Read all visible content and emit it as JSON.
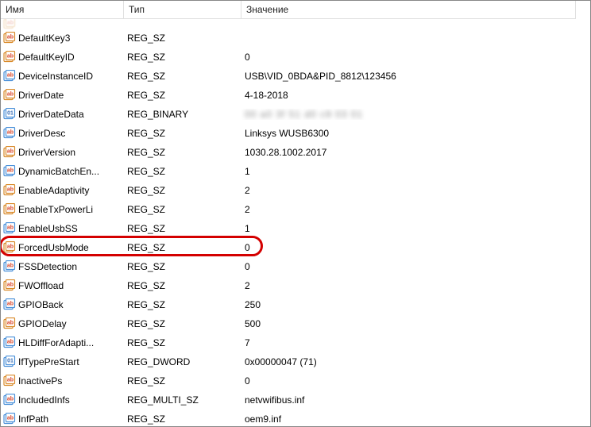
{
  "columns": {
    "name": "Имя",
    "type": "Тип",
    "value": "Значение"
  },
  "icon_map": {
    "ab": {
      "bg": "#fff",
      "border": "#d98a2a",
      "text": "#d9462a",
      "glyph": "ab"
    },
    "ab_alt": {
      "bg": "#fff",
      "border": "#4a90d9",
      "text": "#d9462a",
      "glyph": "ab"
    },
    "bin": {
      "bg": "#fff",
      "border": "#4a90d9",
      "text": "#3a6fb7",
      "glyph": "01"
    }
  },
  "rows": [
    {
      "name": "DefaultKey3",
      "type": "REG_SZ",
      "value": "",
      "icon": "ab"
    },
    {
      "name": "DefaultKeyID",
      "type": "REG_SZ",
      "value": "0",
      "icon": "ab"
    },
    {
      "name": "DeviceInstanceID",
      "type": "REG_SZ",
      "value": "USB\\VID_0BDA&PID_8812\\123456",
      "icon": "ab_alt"
    },
    {
      "name": "DriverDate",
      "type": "REG_SZ",
      "value": "4-18-2018",
      "icon": "ab"
    },
    {
      "name": "DriverDateData",
      "type": "REG_BINARY",
      "value": "blurred",
      "icon": "bin",
      "blurred": true
    },
    {
      "name": "DriverDesc",
      "type": "REG_SZ",
      "value": "Linksys WUSB6300",
      "icon": "ab_alt"
    },
    {
      "name": "DriverVersion",
      "type": "REG_SZ",
      "value": "1030.28.1002.2017",
      "icon": "ab"
    },
    {
      "name": "DynamicBatchEn...",
      "type": "REG_SZ",
      "value": "1",
      "icon": "ab_alt"
    },
    {
      "name": "EnableAdaptivity",
      "type": "REG_SZ",
      "value": "2",
      "icon": "ab"
    },
    {
      "name": "EnableTxPowerLi",
      "type": "REG_SZ",
      "value": "2",
      "icon": "ab"
    },
    {
      "name": "EnableUsbSS",
      "type": "REG_SZ",
      "value": "1",
      "icon": "ab_alt"
    },
    {
      "name": "ForcedUsbMode",
      "type": "REG_SZ",
      "value": "0",
      "icon": "ab",
      "highlight": true
    },
    {
      "name": "FSSDetection",
      "type": "REG_SZ",
      "value": "0",
      "icon": "ab_alt"
    },
    {
      "name": "FWOffload",
      "type": "REG_SZ",
      "value": "2",
      "icon": "ab"
    },
    {
      "name": "GPIOBack",
      "type": "REG_SZ",
      "value": "250",
      "icon": "ab_alt"
    },
    {
      "name": "GPIODelay",
      "type": "REG_SZ",
      "value": "500",
      "icon": "ab"
    },
    {
      "name": "HLDiffForAdapti...",
      "type": "REG_SZ",
      "value": "7",
      "icon": "ab_alt"
    },
    {
      "name": "IfTypePreStart",
      "type": "REG_DWORD",
      "value": "0x00000047 (71)",
      "icon": "bin"
    },
    {
      "name": "InactivePs",
      "type": "REG_SZ",
      "value": "0",
      "icon": "ab"
    },
    {
      "name": "IncludedInfs",
      "type": "REG_MULTI_SZ",
      "value": "netvwifibus.inf",
      "icon": "ab_alt"
    },
    {
      "name": "InfPath",
      "type": "REG_SZ",
      "value": "oem9.inf",
      "icon": "ab_alt"
    }
  ]
}
